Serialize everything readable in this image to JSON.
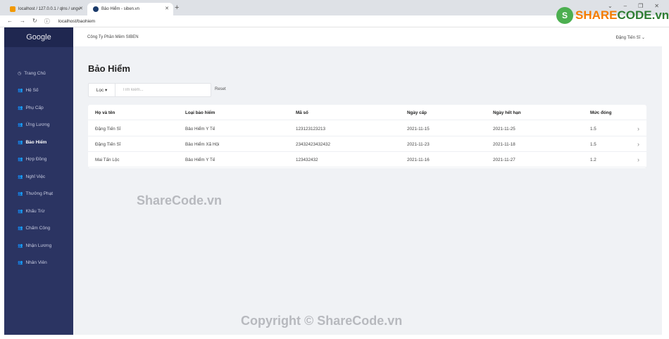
{
  "browser": {
    "tabs": [
      {
        "title": "localhost / 127.0.0.1 / qlns / ungv"
      },
      {
        "title": "Bảo Hiểm - siben.vn"
      }
    ],
    "url": "localhost/baohiem"
  },
  "sidebar": {
    "brand": "Google",
    "items": [
      {
        "label": "Trang Chủ",
        "icon": "dashboard-icon"
      },
      {
        "label": "Hệ Số",
        "icon": "users-icon"
      },
      {
        "label": "Phụ Cấp",
        "icon": "users-icon"
      },
      {
        "label": "Ứng Lương",
        "icon": "users-icon"
      },
      {
        "label": "Bảo Hiểm",
        "icon": "users-icon",
        "active": true
      },
      {
        "label": "Hợp Đồng",
        "icon": "users-icon"
      },
      {
        "label": "Nghỉ Việc",
        "icon": "users-icon"
      },
      {
        "label": "Thưởng Phạt",
        "icon": "users-icon"
      },
      {
        "label": "Khấu Trừ",
        "icon": "users-icon"
      },
      {
        "label": "Chấm Công",
        "icon": "users-icon"
      },
      {
        "label": "Nhận Lương",
        "icon": "users-icon"
      },
      {
        "label": "Nhân Viên",
        "icon": "users-icon"
      }
    ]
  },
  "header": {
    "company": "Công Ty Phần Mềm SIBEN",
    "user": "Đặng Tiến Sĩ"
  },
  "main": {
    "title": "Bảo Hiểm",
    "filter": {
      "label": "Lọc",
      "search_placeholder": "Tìm kiếm...",
      "reset_label": "Reset"
    },
    "table": {
      "columns": [
        "Họ và tên",
        "Loại bảo hiểm",
        "Mã số",
        "Ngày cấp",
        "Ngày hết hạn",
        "Mức đóng"
      ],
      "rows": [
        [
          "Đặng Tiến Sĩ",
          "Bảo Hiểm Y Tế",
          "123123123213",
          "2021-11-15",
          "2021-11-25",
          "1.5"
        ],
        [
          "Đặng Tiến Sĩ",
          "Bảo Hiểm Xã Hội",
          "23432423432432",
          "2021-11-23",
          "2021-11-18",
          "1.5"
        ],
        [
          "Mai Tấn Lộc",
          "Bảo Hiểm Y Tế",
          "123432432",
          "2021-11-16",
          "2021-11-27",
          "1.2"
        ]
      ]
    }
  },
  "watermark": {
    "center": "ShareCode.vn",
    "footer": "Copyright © ShareCode.vn",
    "logo_a": "SHARE",
    "logo_b": "CODE.vn"
  }
}
